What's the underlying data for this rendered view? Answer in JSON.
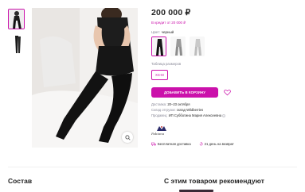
{
  "product": {
    "price": "200 000 ₽",
    "credit": "В кредит от 20 000 ₽",
    "color_label": "Цвет:",
    "color_value": "черный",
    "colors": [
      "черный",
      "серый",
      "серый светлый"
    ],
    "size_label": "Таблица размеров",
    "size_value": "XS-M",
    "add_to_cart": "ДОБАВИТЬ В КОРЗИНУ",
    "delivery_label": "Доставка:",
    "delivery_value": "20–23 октября",
    "warehouse_label": "Склад отгрузки:",
    "warehouse_value": "склад Wildberries",
    "seller_label": "Продавец:",
    "seller_value": "ИП Субботина Мария Алексеевна",
    "brand_name": "Fabiana",
    "free_delivery": "Бесплатная доставка",
    "return_text": "21 день на возврат"
  },
  "sections": {
    "composition_title": "Состав",
    "recommend_title": "С этим товаром рекомендуют"
  },
  "colors": {
    "accent": "#cb11ab",
    "text": "#242424",
    "muted": "#868695"
  }
}
